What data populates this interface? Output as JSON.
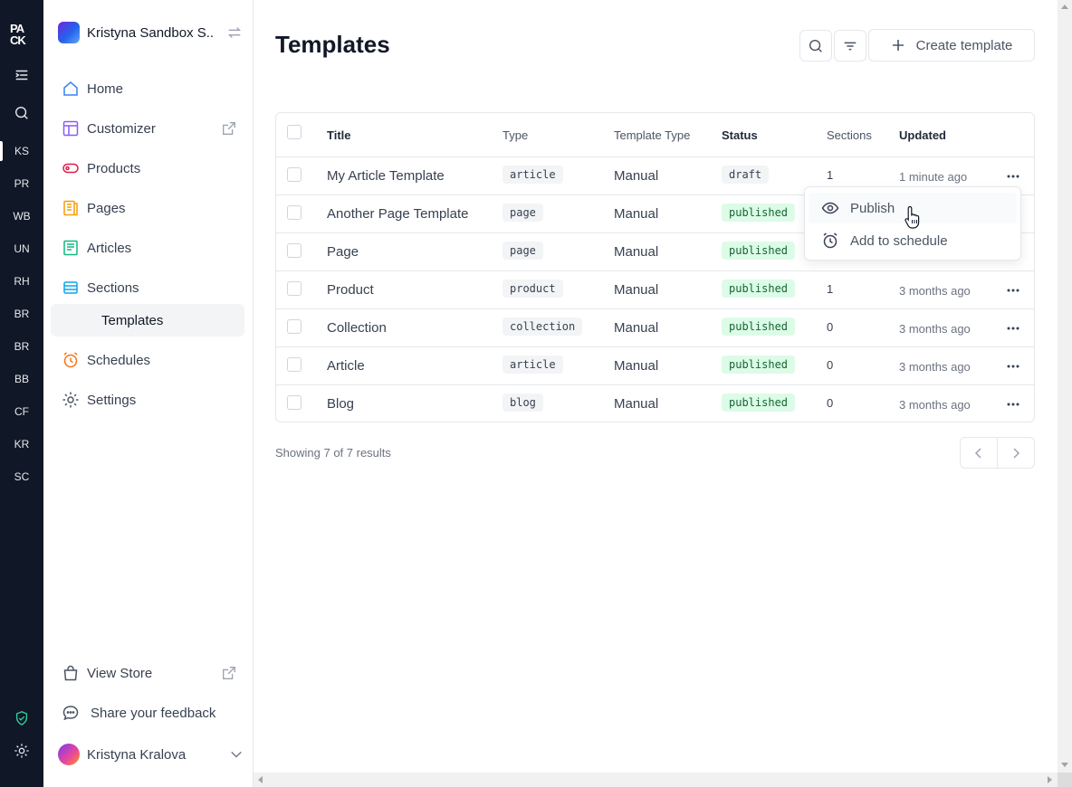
{
  "rail": {
    "logo": "PACK",
    "items": [
      "KS",
      "PR",
      "WB",
      "UN",
      "RH",
      "BR",
      "BR",
      "BB",
      "CF",
      "KR",
      "SC"
    ]
  },
  "sidebar": {
    "workspace_name": "Kristyna Sandbox S...",
    "nav": [
      {
        "label": "Home",
        "icon": "home-icon"
      },
      {
        "label": "Customizer",
        "icon": "layout-icon"
      },
      {
        "label": "Products",
        "icon": "tag-icon"
      },
      {
        "label": "Pages",
        "icon": "pages-icon"
      },
      {
        "label": "Articles",
        "icon": "article-icon"
      },
      {
        "label": "Sections",
        "icon": "sections-icon"
      },
      {
        "label": "Templates",
        "icon": ""
      },
      {
        "label": "Schedules",
        "icon": "alarm-clock-icon"
      },
      {
        "label": "Settings",
        "icon": "gear-icon"
      }
    ],
    "bottom": {
      "view_store": "View Store",
      "feedback": "Share your feedback",
      "user_name": "Kristyna Kralova"
    }
  },
  "main": {
    "title": "Templates",
    "create_label": "Create template",
    "columns": [
      "Title",
      "Type",
      "Template Type",
      "Status",
      "Sections",
      "Updated"
    ],
    "rows": [
      {
        "title": "My Article Template",
        "type": "article",
        "template_type": "Manual",
        "status": "draft",
        "sections": "1",
        "updated": "1 minute ago"
      },
      {
        "title": "Another Page Template",
        "type": "page",
        "template_type": "Manual",
        "status": "published",
        "sections": "",
        "updated": ""
      },
      {
        "title": "Page",
        "type": "page",
        "template_type": "Manual",
        "status": "published",
        "sections": "",
        "updated": ""
      },
      {
        "title": "Product",
        "type": "product",
        "template_type": "Manual",
        "status": "published",
        "sections": "1",
        "updated": "3 months ago"
      },
      {
        "title": "Collection",
        "type": "collection",
        "template_type": "Manual",
        "status": "published",
        "sections": "0",
        "updated": "3 months ago"
      },
      {
        "title": "Article",
        "type": "article",
        "template_type": "Manual",
        "status": "published",
        "sections": "0",
        "updated": "3 months ago"
      },
      {
        "title": "Blog",
        "type": "blog",
        "template_type": "Manual",
        "status": "published",
        "sections": "0",
        "updated": "3 months ago"
      }
    ],
    "footer_text": "Showing 7 of 7 results",
    "menu": {
      "publish": "Publish",
      "schedule": "Add to schedule"
    }
  },
  "colors": {
    "rail_bg": "#101828",
    "published_bg": "#dcfce7",
    "published_text": "#166534"
  }
}
